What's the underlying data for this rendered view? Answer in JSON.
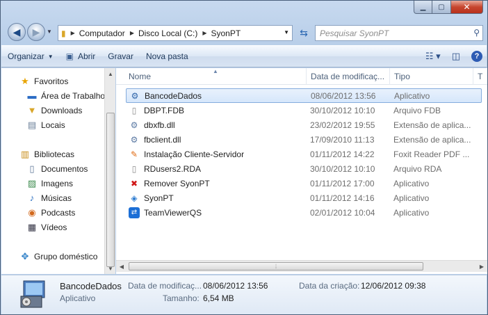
{
  "address": {
    "segments": [
      "Computador",
      "Disco Local (C:)",
      "SyonPT"
    ]
  },
  "search": {
    "placeholder": "Pesquisar SyonPT"
  },
  "toolbar": {
    "organize": "Organizar",
    "open": "Abrir",
    "burn": "Gravar",
    "new_folder": "Nova pasta"
  },
  "nav": {
    "favorites": "Favoritos",
    "desktop": "Área de Trabalho",
    "downloads": "Downloads",
    "places": "Locais",
    "libraries": "Bibliotecas",
    "documents": "Documentos",
    "images": "Imagens",
    "music": "Músicas",
    "podcasts": "Podcasts",
    "videos": "Vídeos",
    "homegroup": "Grupo doméstico"
  },
  "columns": {
    "name": "Nome",
    "date": "Data de modificaç...",
    "type": "Tipo",
    "size": "T"
  },
  "files": [
    {
      "name": "BancodeDados",
      "date": "08/06/2012 13:56",
      "type": "Aplicativo",
      "icon": "setup-icon"
    },
    {
      "name": "DBPT.FDB",
      "date": "30/10/2012 10:10",
      "type": "Arquivo FDB",
      "icon": "blank-file-icon"
    },
    {
      "name": "dbxfb.dll",
      "date": "23/02/2012 19:55",
      "type": "Extensão de aplica...",
      "icon": "dll-icon"
    },
    {
      "name": "fbclient.dll",
      "date": "17/09/2010 11:13",
      "type": "Extensão de aplica...",
      "icon": "dll-icon"
    },
    {
      "name": "Instalação Cliente-Servidor",
      "date": "01/11/2012 14:22",
      "type": "Foxit Reader PDF ...",
      "icon": "pdf-icon"
    },
    {
      "name": "RDusers2.RDA",
      "date": "30/10/2012 10:10",
      "type": "Arquivo RDA",
      "icon": "blank-file-icon"
    },
    {
      "name": "Remover SyonPT",
      "date": "01/11/2012 17:00",
      "type": "Aplicativo",
      "icon": "uninstall-icon"
    },
    {
      "name": "SyonPT",
      "date": "01/11/2012 14:16",
      "type": "Aplicativo",
      "icon": "app-icon"
    },
    {
      "name": "TeamViewerQS",
      "date": "02/01/2012 10:04",
      "type": "Aplicativo",
      "icon": "teamviewer-icon"
    }
  ],
  "details": {
    "name": "BancodeDados",
    "type": "Aplicativo",
    "modified_label": "Data de modificaç...",
    "modified_value": "08/06/2012 13:56",
    "created_label": "Data da criação:",
    "created_value": "12/06/2012 09:38",
    "size_label": "Tamanho:",
    "size_value": "6,54 MB"
  }
}
